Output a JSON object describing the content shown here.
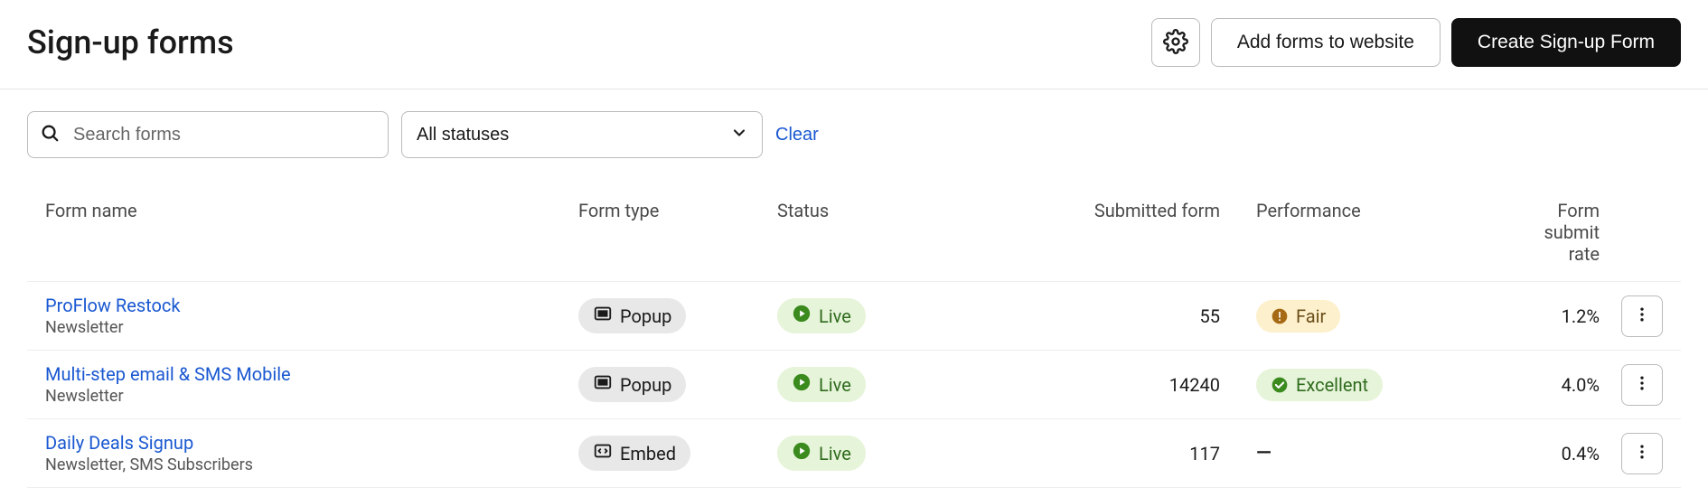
{
  "header": {
    "title": "Sign-up forms",
    "add_forms_label": "Add forms to website",
    "create_label": "Create Sign-up Form"
  },
  "toolbar": {
    "search_placeholder": "Search forms",
    "status_filter_label": "All statuses",
    "clear_label": "Clear"
  },
  "table": {
    "columns": {
      "form_name": "Form name",
      "form_type": "Form type",
      "status": "Status",
      "submitted": "Submitted form",
      "performance": "Performance",
      "submit_rate": "Form submit rate"
    },
    "rows": [
      {
        "name": "ProFlow Restock",
        "subtitle": "Newsletter",
        "type": "Popup",
        "type_icon": "popup",
        "status": "Live",
        "submitted": "55",
        "performance": "Fair",
        "performance_kind": "fair",
        "submit_rate": "1.2%"
      },
      {
        "name": "Multi-step email & SMS Mobile",
        "subtitle": "Newsletter",
        "type": "Popup",
        "type_icon": "popup",
        "status": "Live",
        "submitted": "14240",
        "performance": "Excellent",
        "performance_kind": "excellent",
        "submit_rate": "4.0%"
      },
      {
        "name": "Daily Deals Signup",
        "subtitle": "Newsletter, SMS Subscribers",
        "type": "Embed",
        "type_icon": "embed",
        "status": "Live",
        "submitted": "117",
        "performance": "—",
        "performance_kind": "none",
        "submit_rate": "0.4%"
      }
    ]
  }
}
